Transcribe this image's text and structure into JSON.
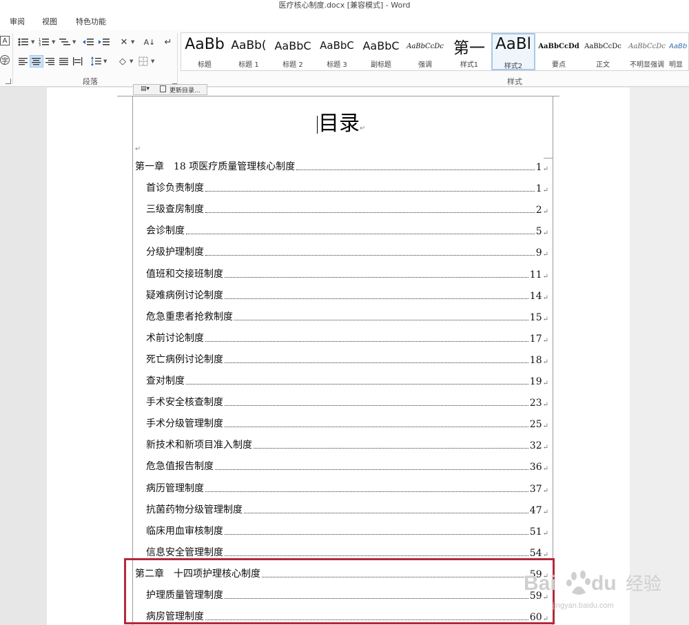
{
  "window": {
    "title": "医疗核心制度.docx [兼容模式] - Word"
  },
  "menu": {
    "tabs": [
      "审阅",
      "视图",
      "特色功能"
    ]
  },
  "ribbon": {
    "paragraph_group_label": "段落",
    "styles_group_label": "样式",
    "styles": [
      {
        "sample": "AaBb",
        "name": "标题"
      },
      {
        "sample": "AaBb(",
        "name": "标题 1"
      },
      {
        "sample": "AaBbC",
        "name": "标题 2"
      },
      {
        "sample": "AaBbC",
        "name": "标题 3"
      },
      {
        "sample": "AaBbC",
        "name": "副标题"
      },
      {
        "sample": "AaBbCcDc",
        "name": "强调"
      },
      {
        "sample": "第一",
        "name": "样式1"
      },
      {
        "sample": "AaBl",
        "name": "样式2"
      },
      {
        "sample": "AaBbCcDd",
        "name": "要点"
      },
      {
        "sample": "AaBbCcDc",
        "name": "正文"
      },
      {
        "sample": "AaBbCcDc",
        "name": "不明显强调"
      },
      {
        "sample": "AaBb",
        "name": "明显"
      }
    ]
  },
  "toc_toolbar": {
    "update_label": "更新目录..."
  },
  "document": {
    "title": "目录",
    "entries": [
      {
        "text": "第一章　18 项医疗质量管理核心制度",
        "page": "1",
        "level": 1
      },
      {
        "text": "首诊负责制度",
        "page": "1",
        "level": 2
      },
      {
        "text": "三级查房制度",
        "page": "2",
        "level": 2
      },
      {
        "text": "会诊制度",
        "page": "5",
        "level": 2
      },
      {
        "text": "分级护理制度",
        "page": "9",
        "level": 2
      },
      {
        "text": "值班和交接班制度",
        "page": "11",
        "level": 2
      },
      {
        "text": "疑难病例讨论制度",
        "page": "14",
        "level": 2
      },
      {
        "text": "危急重患者抢救制度",
        "page": "15",
        "level": 2
      },
      {
        "text": "术前讨论制度",
        "page": "17",
        "level": 2
      },
      {
        "text": "死亡病例讨论制度",
        "page": "18",
        "level": 2
      },
      {
        "text": "查对制度",
        "page": "19",
        "level": 2
      },
      {
        "text": "手术安全核查制度",
        "page": "23",
        "level": 2
      },
      {
        "text": "手术分级管理制度",
        "page": "25",
        "level": 2
      },
      {
        "text": "新技术和新项目准入制度",
        "page": "32",
        "level": 2
      },
      {
        "text": "危急值报告制度",
        "page": "36",
        "level": 2
      },
      {
        "text": "病历管理制度",
        "page": "37",
        "level": 2
      },
      {
        "text": "抗菌药物分级管理制度",
        "page": "47",
        "level": 2
      },
      {
        "text": "临床用血审核制度",
        "page": "51",
        "level": 2
      },
      {
        "text": "信息安全管理制度",
        "page": "54",
        "level": 2
      },
      {
        "text": "第二章　十四项护理核心制度",
        "page": "59",
        "level": 1
      },
      {
        "text": "护理质量管理制度",
        "page": "59",
        "level": 2
      },
      {
        "text": "病房管理制度",
        "page": "60",
        "level": 2
      }
    ]
  },
  "watermark": {
    "text": "Bai du 经验",
    "url": "jingyan.baidu.com"
  }
}
